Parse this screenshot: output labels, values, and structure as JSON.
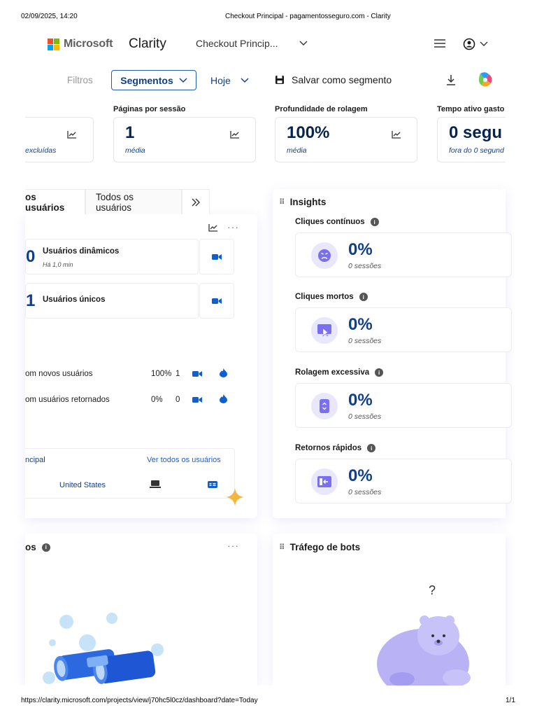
{
  "print": {
    "datetime": "02/09/2025, 14:20",
    "doc_title": "Checkout Principal - pagamentosseguro.com - Clarity",
    "url": "https://clarity.microsoft.com/projects/view/j70hc5l0cz/dashboard?date=Today",
    "page": "1/1"
  },
  "header": {
    "brand": "Microsoft",
    "app": "Clarity",
    "project": "Checkout Princip...",
    "icons": [
      "chevron-down-icon",
      "hamburger-menu-icon",
      "account-icon",
      "copilot-icon"
    ]
  },
  "filters": {
    "filtros": "Filtros",
    "segmentos": "Segmentos",
    "date": "Hoje",
    "save": "Salvar como segmento"
  },
  "metrics": [
    {
      "label": "",
      "value": "",
      "sub": "excluídas"
    },
    {
      "label": "Páginas por sessão",
      "value": "1",
      "sub": "média"
    },
    {
      "label": "Profundidade de rolagem",
      "value": "100%",
      "sub": "média"
    },
    {
      "label": "Tempo ativo gasto",
      "value": "0 segu",
      "sub": "fora do 0 segund"
    }
  ],
  "users": {
    "tabs": [
      "os usuários",
      "Todos os usuários"
    ],
    "live": {
      "num": "0",
      "title": "Usuários dinâmicos",
      "sub": "Há 1,0 min"
    },
    "unique": {
      "num": "1",
      "title": "Usuários únicos"
    },
    "segments": [
      {
        "label": "om novos usuários",
        "pct": "100%",
        "count": "1"
      },
      {
        "label": "om usuários retornados",
        "pct": "0%",
        "count": "0"
      }
    ],
    "footer_left": "ncipal",
    "footer_link": "Ver todos os usuários",
    "country": "United States"
  },
  "insights": {
    "title": "Insights",
    "items": [
      {
        "title": "Cliques contínuos",
        "value": "0%",
        "sub": "0 sessões"
      },
      {
        "title": "Cliques mortos",
        "value": "0%",
        "sub": "0 sessões"
      },
      {
        "title": "Rolagem excessiva",
        "value": "0%",
        "sub": "0 sessões"
      },
      {
        "title": "Retornos rápidos",
        "value": "0%",
        "sub": "0 sessões"
      }
    ]
  },
  "bottom": {
    "left_title": "os",
    "right_title": "Tráfego de bots",
    "question": "?"
  },
  "colors": {
    "accent": "#0f3f8a",
    "metric_value": "#07244f",
    "insight_bg": "#e9e7fb",
    "insight_icon": "#6a5ee8",
    "star": "#f3b640"
  }
}
